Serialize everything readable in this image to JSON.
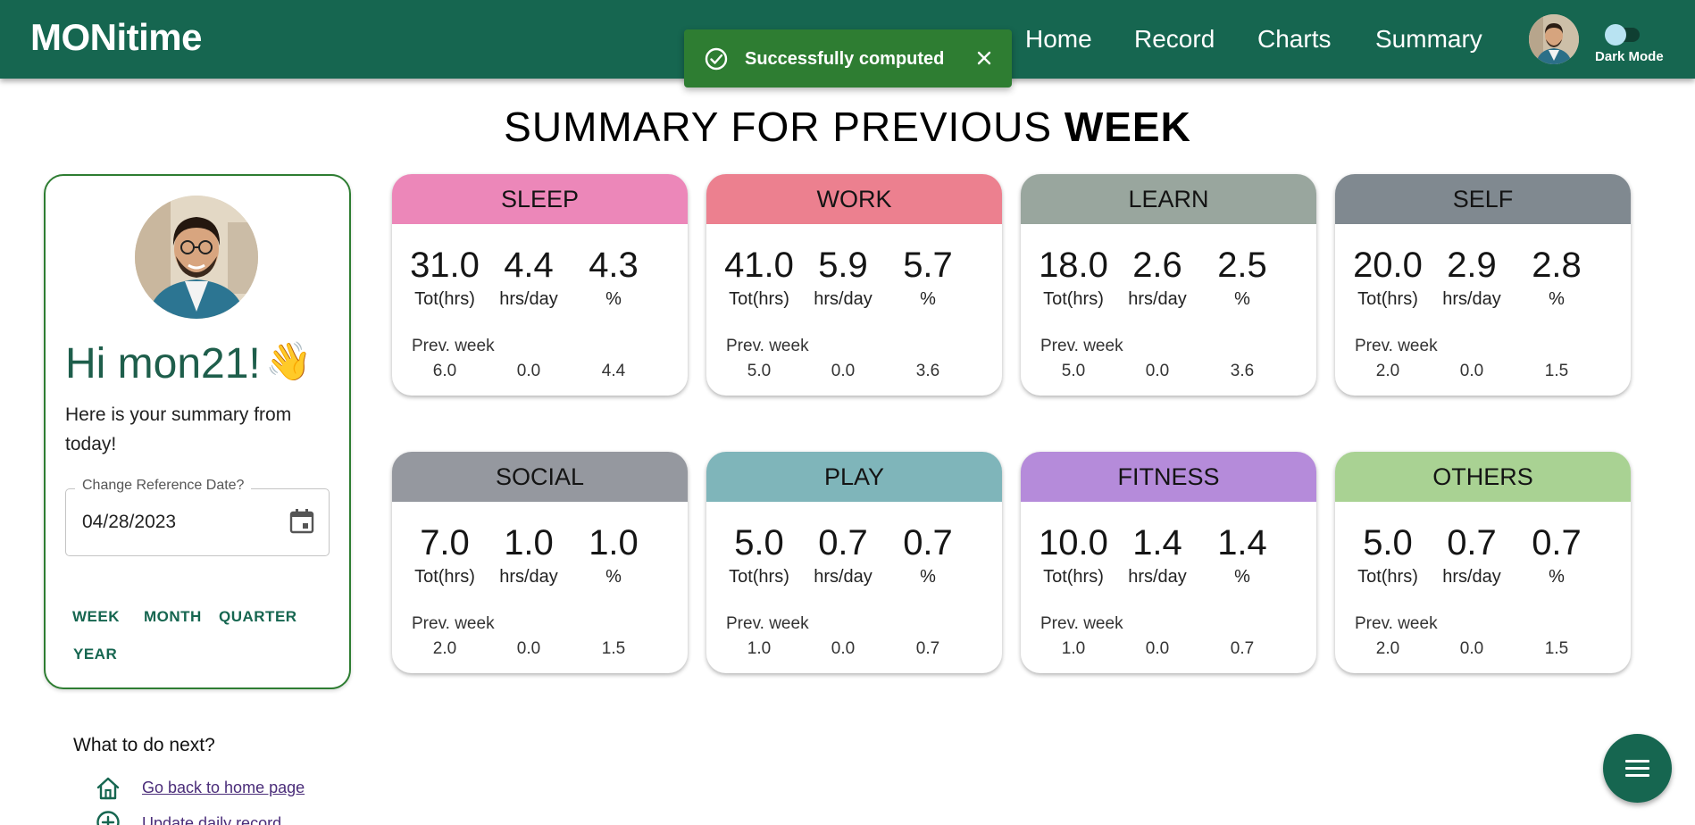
{
  "app": {
    "logo": "MONitime",
    "nav": [
      "Home",
      "Record",
      "Charts",
      "Summary"
    ],
    "dark_mode_label": "Dark Mode"
  },
  "snackbar": {
    "message": "Successfully computed"
  },
  "heading": {
    "prefix": "SUMMARY FOR PREVIOUS",
    "bold": "WEEK"
  },
  "profile": {
    "greeting": "Hi mon21!",
    "intro": "Here is your summary from today!",
    "date_label": "Change Reference Date?",
    "date_value": "04/28/2023",
    "ranges": [
      "WEEK",
      "MONTH",
      "QUARTER",
      "YEAR"
    ]
  },
  "stat_labels": {
    "total": "Tot(hrs)",
    "per_day": "hrs/day",
    "percent": "%",
    "prev": "Prev. week"
  },
  "categories": [
    {
      "name": "SLEEP",
      "color": "#ec87b9",
      "total": "31.0",
      "per_day": "4.4",
      "percent": "4.3",
      "prev_total": "6.0",
      "prev_per_day": "0.0",
      "prev_percent": "4.4"
    },
    {
      "name": "WORK",
      "color": "#ec808f",
      "total": "41.0",
      "per_day": "5.9",
      "percent": "5.7",
      "prev_total": "5.0",
      "prev_per_day": "0.0",
      "prev_percent": "3.6"
    },
    {
      "name": "LEARN",
      "color": "#99a69e",
      "total": "18.0",
      "per_day": "2.6",
      "percent": "2.5",
      "prev_total": "5.0",
      "prev_per_day": "0.0",
      "prev_percent": "3.6"
    },
    {
      "name": "SELF",
      "color": "#808990",
      "total": "20.0",
      "per_day": "2.9",
      "percent": "2.8",
      "prev_total": "2.0",
      "prev_per_day": "0.0",
      "prev_percent": "1.5"
    },
    {
      "name": "SOCIAL",
      "color": "#95989f",
      "total": "7.0",
      "per_day": "1.0",
      "percent": "1.0",
      "prev_total": "2.0",
      "prev_per_day": "0.0",
      "prev_percent": "1.5"
    },
    {
      "name": "PLAY",
      "color": "#7fb5ba",
      "total": "5.0",
      "per_day": "0.7",
      "percent": "0.7",
      "prev_total": "1.0",
      "prev_per_day": "0.0",
      "prev_percent": "0.7"
    },
    {
      "name": "FITNESS",
      "color": "#b58bda",
      "total": "10.0",
      "per_day": "1.4",
      "percent": "1.4",
      "prev_total": "1.0",
      "prev_per_day": "0.0",
      "prev_percent": "0.7"
    },
    {
      "name": "OTHERS",
      "color": "#a9d293",
      "total": "5.0",
      "per_day": "0.7",
      "percent": "0.7",
      "prev_total": "2.0",
      "prev_per_day": "0.0",
      "prev_percent": "1.5"
    }
  ],
  "next": {
    "title": "What to do next?",
    "links": [
      "Go back to home page",
      "Update daily record"
    ]
  },
  "colors": {
    "primary": "#166650",
    "success": "#2e7d32",
    "link": "#4a2c79"
  }
}
